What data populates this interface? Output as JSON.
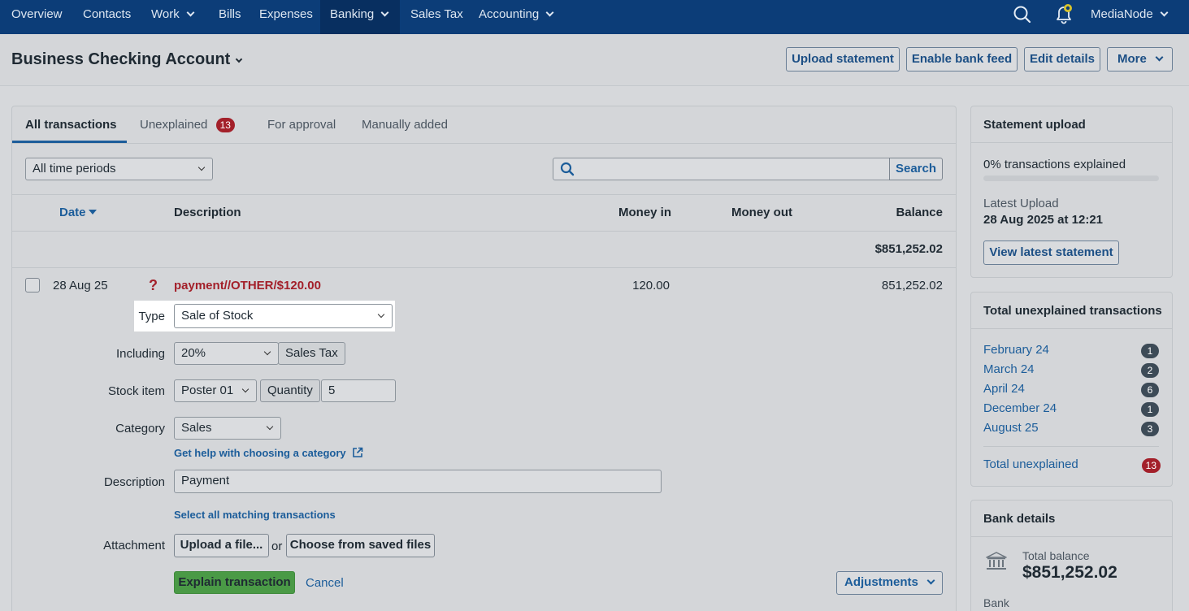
{
  "nav": {
    "items": [
      {
        "label": "Overview"
      },
      {
        "label": "Contacts"
      },
      {
        "label": "Work"
      },
      {
        "label": "Bills"
      },
      {
        "label": "Expenses"
      },
      {
        "label": "Banking"
      },
      {
        "label": "Sales Tax"
      },
      {
        "label": "Accounting"
      }
    ],
    "active": "Banking",
    "company": "MediaNode",
    "colors": {
      "nav_bg": "#0c3d78",
      "active_bg": "#082f60"
    }
  },
  "header": {
    "title": "Business Checking Account",
    "buttons": {
      "upload": "Upload statement",
      "enable_feed": "Enable bank feed",
      "edit": "Edit details",
      "more": "More"
    }
  },
  "tabs": {
    "all": "All transactions",
    "unexplained": "Unexplained",
    "unexplained_count": "13",
    "approval": "For approval",
    "manual": "Manually added"
  },
  "filters": {
    "period": "All time periods",
    "search_value": "",
    "search_button": "Search"
  },
  "table": {
    "headers": {
      "date": "Date",
      "description": "Description",
      "money_in": "Money in",
      "money_out": "Money out",
      "balance": "Balance"
    },
    "opening_balance": "$851,252.02",
    "row": {
      "date": "28 Aug 25",
      "status": "?",
      "description": "payment//OTHER/$120.00",
      "money_in": "120.00",
      "money_out": "",
      "balance": "851,252.02"
    }
  },
  "form": {
    "type_label": "Type",
    "type_value": "Sale of Stock",
    "including_label": "Including",
    "including_value": "20%",
    "including_addon": "Sales Tax",
    "stock_label": "Stock item",
    "stock_value": "Poster 01",
    "quantity_label": "Quantity",
    "quantity_value": "5",
    "category_label": "Category",
    "category_value": "Sales",
    "category_help": "Get help with choosing a category",
    "description_label": "Description",
    "description_value": "Payment",
    "select_matching": "Select all matching transactions",
    "attachment_label": "Attachment",
    "upload_button": "Upload a file...",
    "or_text": "or",
    "choose_button": "Choose from saved files",
    "explain_button": "Explain transaction",
    "cancel": "Cancel",
    "adjustments": "Adjustments",
    "colors": {
      "explain_bg": "#4a9a46",
      "error_red": "#a3202a",
      "link_blue": "#1c5d9a"
    }
  },
  "sidebar": {
    "statement": {
      "title": "Statement upload",
      "explained": "0% transactions explained",
      "explained_fraction": 0,
      "latest_label": "Latest Upload",
      "latest_value": "28 Aug 2025 at 12:21",
      "view_button": "View latest statement"
    },
    "unexplained": {
      "title": "Total unexplained transactions",
      "months": [
        {
          "label": "February 24",
          "count": "1"
        },
        {
          "label": "March 24",
          "count": "2"
        },
        {
          "label": "April 24",
          "count": "6"
        },
        {
          "label": "December 24",
          "count": "1"
        },
        {
          "label": "August 25",
          "count": "3"
        }
      ],
      "total_label": "Total unexplained",
      "total_count": "13"
    },
    "bank": {
      "title": "Bank details",
      "balance_label": "Total balance",
      "balance_value": "$851,252.02",
      "bank_label": "Bank"
    }
  }
}
